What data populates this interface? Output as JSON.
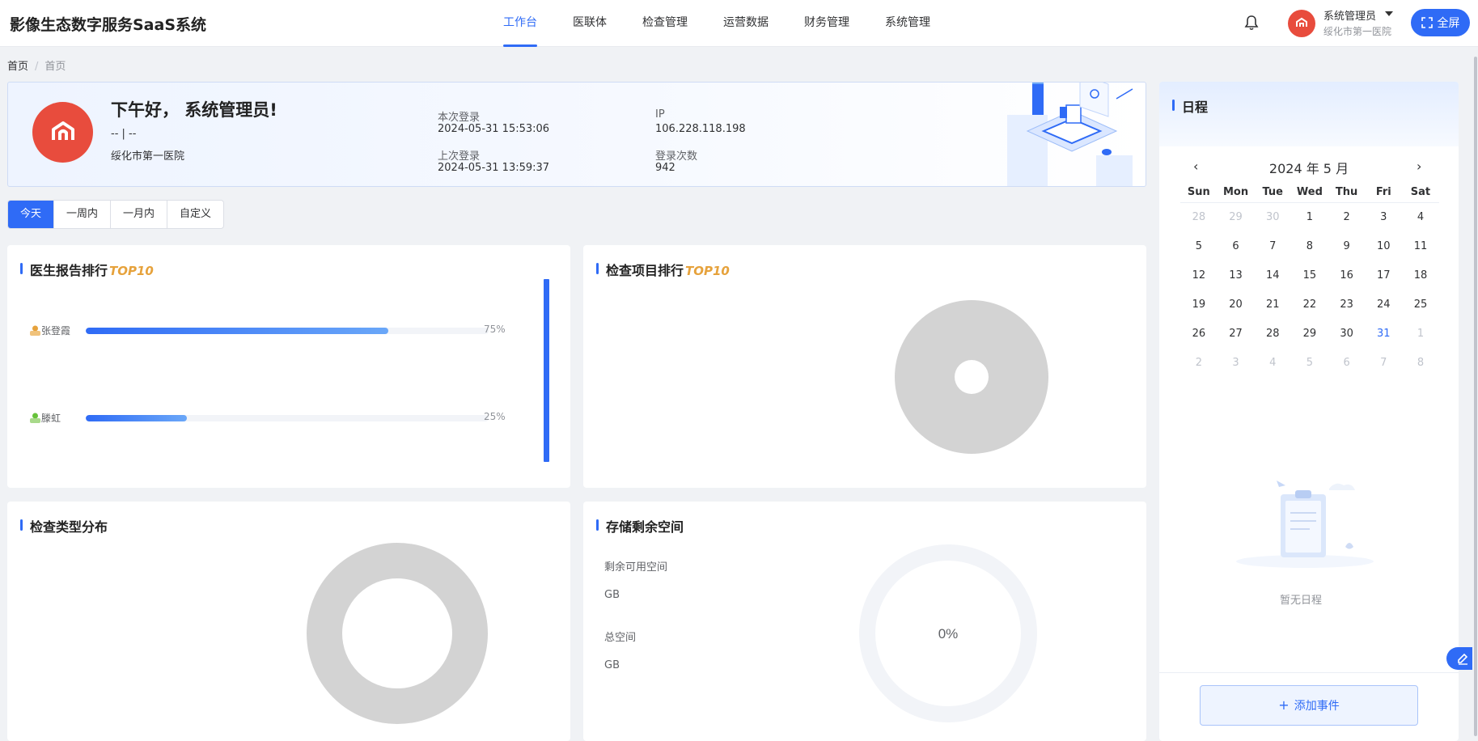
{
  "header": {
    "app_title": "影像生态数字服务SaaS系统",
    "nav": [
      {
        "label": "工作台",
        "active": true
      },
      {
        "label": "医联体",
        "active": false
      },
      {
        "label": "检查管理",
        "active": false
      },
      {
        "label": "运营数据",
        "active": false
      },
      {
        "label": "财务管理",
        "active": false
      },
      {
        "label": "系统管理",
        "active": false
      }
    ],
    "user_name": "系统管理员",
    "user_org": "绥化市第一医院",
    "fullscreen_label": "全屏"
  },
  "breadcrumb": {
    "root": "首页",
    "separator": "/",
    "current": "首页"
  },
  "welcome": {
    "greeting": "下午好， 系统管理员!",
    "sub": "-- | --",
    "org": "绥化市第一医院",
    "this_login_label": "本次登录",
    "this_login_value": "2024-05-31 15:53:06",
    "last_login_label": "上次登录",
    "last_login_value": "2024-05-31 13:59:37",
    "ip_label": "IP",
    "ip_value": "106.228.118.198",
    "count_label": "登录次数",
    "count_value": "942"
  },
  "range_tabs": [
    {
      "label": "今天",
      "active": true
    },
    {
      "label": "一周内",
      "active": false
    },
    {
      "label": "一月内",
      "active": false
    },
    {
      "label": "自定义",
      "active": false
    }
  ],
  "doctor_rank": {
    "title": "医生报告排行",
    "badge": "TOP10",
    "rows": [
      {
        "name": "张登霞",
        "percent": 75,
        "percent_label": "75%",
        "icon_color": "#e6a23c"
      },
      {
        "name": "滕虹",
        "percent": 25,
        "percent_label": "25%",
        "icon_color": "#67c23a"
      }
    ]
  },
  "exam_rank": {
    "title": "检查项目排行",
    "badge": "TOP10"
  },
  "exam_types": {
    "title": "检查类型分布"
  },
  "storage": {
    "title": "存储剩余空间",
    "available_label": "剩余可用空间",
    "available_unit": "GB",
    "total_label": "总空间",
    "total_unit": "GB",
    "percent_label": "0%"
  },
  "calendar": {
    "title": "日程",
    "month_label": "2024 年 5 月",
    "prev": "‹",
    "next": "›",
    "weekdays": [
      "Sun",
      "Mon",
      "Tue",
      "Wed",
      "Thu",
      "Fri",
      "Sat"
    ],
    "weeks": [
      [
        {
          "d": "28",
          "o": true
        },
        {
          "d": "29",
          "o": true
        },
        {
          "d": "30",
          "o": true
        },
        {
          "d": "1"
        },
        {
          "d": "2"
        },
        {
          "d": "3"
        },
        {
          "d": "4"
        }
      ],
      [
        {
          "d": "5"
        },
        {
          "d": "6"
        },
        {
          "d": "7"
        },
        {
          "d": "8"
        },
        {
          "d": "9"
        },
        {
          "d": "10"
        },
        {
          "d": "11"
        }
      ],
      [
        {
          "d": "12"
        },
        {
          "d": "13"
        },
        {
          "d": "14"
        },
        {
          "d": "15"
        },
        {
          "d": "16"
        },
        {
          "d": "17"
        },
        {
          "d": "18"
        }
      ],
      [
        {
          "d": "19"
        },
        {
          "d": "20"
        },
        {
          "d": "21"
        },
        {
          "d": "22"
        },
        {
          "d": "23"
        },
        {
          "d": "24"
        },
        {
          "d": "25"
        }
      ],
      [
        {
          "d": "26"
        },
        {
          "d": "27"
        },
        {
          "d": "28"
        },
        {
          "d": "29"
        },
        {
          "d": "30"
        },
        {
          "d": "31",
          "t": true
        },
        {
          "d": "1",
          "o": true
        }
      ],
      [
        {
          "d": "2",
          "o": true
        },
        {
          "d": "3",
          "o": true
        },
        {
          "d": "4",
          "o": true
        },
        {
          "d": "5",
          "o": true
        },
        {
          "d": "6",
          "o": true
        },
        {
          "d": "7",
          "o": true
        },
        {
          "d": "8",
          "o": true
        }
      ]
    ],
    "empty_text": "暂无日程",
    "add_label": "添加事件"
  },
  "colors": {
    "primary": "#2f6bf6",
    "brand_red": "#e84c3d",
    "gold": "#e6a23c",
    "placeholder_gray": "#d3d3d3"
  }
}
